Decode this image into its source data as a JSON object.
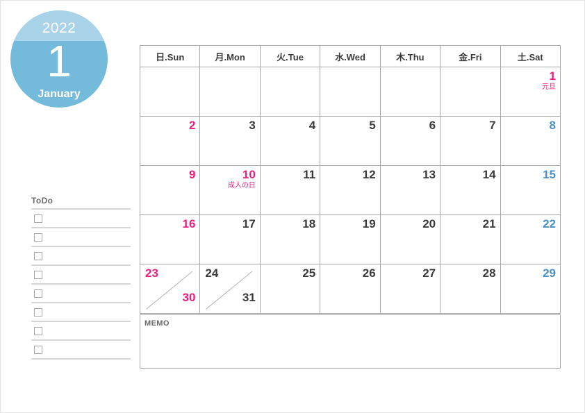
{
  "badge": {
    "year": "2022",
    "month_number": "1",
    "month_name": "January"
  },
  "colors": {
    "badge_light": "#a8d3e9",
    "badge_dark": "#74badb",
    "sunday_pink": "#ec1e7b",
    "sunday_header_bg": "#fae9e9",
    "sunday_header_text": "#ef6a78",
    "saturday_blue": "#4a90c8",
    "saturday_header_bg": "#ddeef8",
    "weekday_text": "#3a3a3a",
    "grid_line": "#a8a8a8",
    "rule_gray": "#d6d6d6"
  },
  "calendar": {
    "weekdays": [
      {
        "label": "日.Sun",
        "kind": "sun"
      },
      {
        "label": "月.Mon",
        "kind": "weekday"
      },
      {
        "label": "火.Tue",
        "kind": "weekday"
      },
      {
        "label": "水.Wed",
        "kind": "weekday"
      },
      {
        "label": "木.Thu",
        "kind": "weekday"
      },
      {
        "label": "金.Fri",
        "kind": "weekday"
      },
      {
        "label": "土.Sat",
        "kind": "sat"
      }
    ],
    "weeks": [
      [
        {
          "date": ""
        },
        {
          "date": ""
        },
        {
          "date": ""
        },
        {
          "date": ""
        },
        {
          "date": ""
        },
        {
          "date": ""
        },
        {
          "date": "1",
          "kind": "hol",
          "note": "元旦"
        }
      ],
      [
        {
          "date": "2",
          "kind": "sun"
        },
        {
          "date": "3"
        },
        {
          "date": "4"
        },
        {
          "date": "5"
        },
        {
          "date": "6"
        },
        {
          "date": "7"
        },
        {
          "date": "8",
          "kind": "sat"
        }
      ],
      [
        {
          "date": "9",
          "kind": "sun"
        },
        {
          "date": "10",
          "kind": "hol",
          "note": "成人の日"
        },
        {
          "date": "11"
        },
        {
          "date": "12"
        },
        {
          "date": "13"
        },
        {
          "date": "14"
        },
        {
          "date": "15",
          "kind": "sat"
        }
      ],
      [
        {
          "date": "16",
          "kind": "sun"
        },
        {
          "date": "17"
        },
        {
          "date": "18"
        },
        {
          "date": "19"
        },
        {
          "date": "20"
        },
        {
          "date": "21"
        },
        {
          "date": "22",
          "kind": "sat"
        }
      ],
      [
        {
          "date": "23",
          "second_date": "30",
          "kind": "sun",
          "split": true
        },
        {
          "date": "24",
          "second_date": "31",
          "split": true
        },
        {
          "date": "25"
        },
        {
          "date": "26"
        },
        {
          "date": "27"
        },
        {
          "date": "28"
        },
        {
          "date": "29",
          "kind": "sat"
        }
      ]
    ]
  },
  "todo": {
    "title": "ToDo",
    "rows": [
      "",
      "",
      "",
      "",
      "",
      "",
      "",
      ""
    ]
  },
  "memo": {
    "label": "MEMO",
    "value": ""
  }
}
